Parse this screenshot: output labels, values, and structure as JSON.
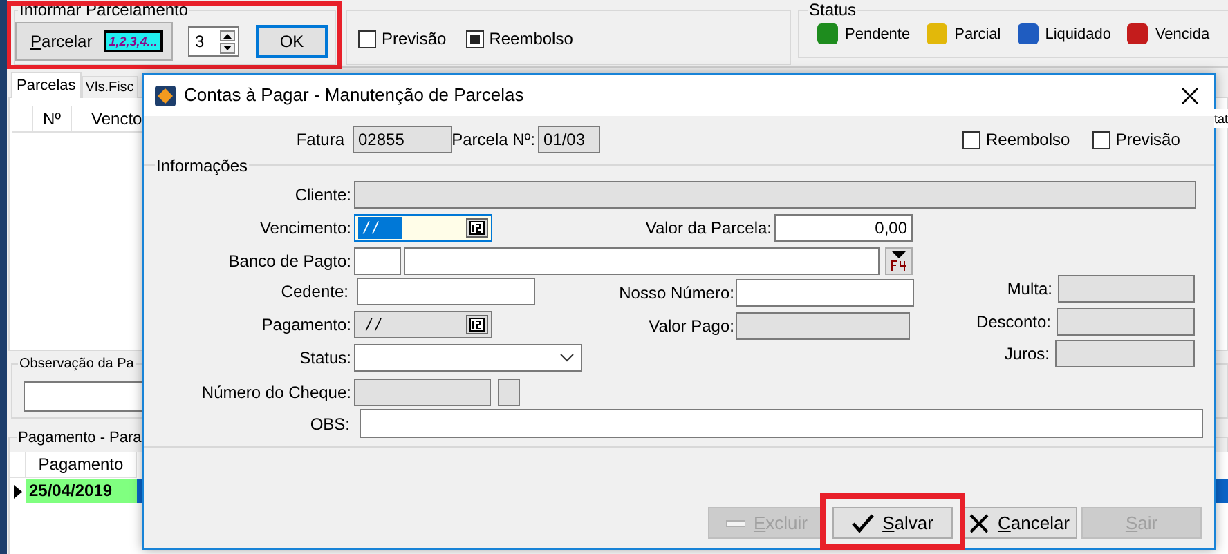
{
  "parcelamento": {
    "title": "Informar Parcelamento",
    "button": "Parcelar",
    "badge": "1,2,3,4...",
    "count": "3",
    "ok": "OK"
  },
  "options": [
    {
      "label": "Previsão",
      "checked": false
    },
    {
      "label": "Reembolso",
      "checked": true
    }
  ],
  "status_legend": {
    "title": "Status",
    "items": [
      {
        "label": "Pendente",
        "color": "#1e8c1e"
      },
      {
        "label": "Parcial",
        "color": "#e2b80a"
      },
      {
        "label": "Liquidado",
        "color": "#1f5cc0"
      },
      {
        "label": "Vencida",
        "color": "#c41c1c"
      }
    ]
  },
  "tabs": [
    {
      "label": "Parcelas",
      "selected": true
    },
    {
      "label": "Vls.Fisc",
      "selected": false
    }
  ],
  "parcelas_table": {
    "columns": [
      "Nº",
      "Vencto"
    ],
    "column_right": "tat"
  },
  "observacao": {
    "title": "Observação da Pa"
  },
  "pagamentos": {
    "title": "Pagamento - Para",
    "columns": [
      "Pagamento"
    ],
    "rows": [
      {
        "cells": [
          "25/04/2019"
        ],
        "selected": true
      }
    ]
  },
  "dialog": {
    "title": "Contas à Pagar - Manutenção de Parcelas",
    "fatura": {
      "label": "Fatura",
      "value": "02855"
    },
    "parcela": {
      "label": "Parcela Nº:",
      "value": "01/03"
    },
    "flags": [
      {
        "label": "Reembolso",
        "checked": false
      },
      {
        "label": "Previsão",
        "checked": false
      }
    ],
    "section": "Informações",
    "fields": {
      "cliente": {
        "label": "Cliente:",
        "disabled": true
      },
      "vencimento": {
        "label": "Vencimento:",
        "value": "/ /"
      },
      "valor_parcela": {
        "label": "Valor da Parcela:",
        "value": "0,00",
        "disabled": false
      },
      "banco": {
        "label": "Banco de Pagto:",
        "disabled": false
      },
      "cedente": {
        "label": "Cedente:",
        "disabled": false
      },
      "nosso_numero": {
        "label": "Nosso Número:",
        "disabled": false
      },
      "multa": {
        "label": "Multa:",
        "disabled": true
      },
      "pagamento": {
        "label": "Pagamento:",
        "value": "/ /",
        "disabled": true
      },
      "valor_pago": {
        "label": "Valor Pago:",
        "disabled": true
      },
      "desconto": {
        "label": "Desconto:",
        "disabled": true
      },
      "status": {
        "label": "Status:",
        "disabled": false
      },
      "juros": {
        "label": "Juros:",
        "disabled": true
      },
      "cheque": {
        "label": "Número do Cheque:",
        "disabled": true
      },
      "obs": {
        "label": "OBS:",
        "disabled": false
      }
    },
    "buttons": [
      {
        "label": "Excluir",
        "disabled": true
      },
      {
        "label": "Salvar",
        "disabled": false
      },
      {
        "label": "Cancelar",
        "disabled": false
      },
      {
        "label": "Sair",
        "disabled": true
      }
    ]
  }
}
